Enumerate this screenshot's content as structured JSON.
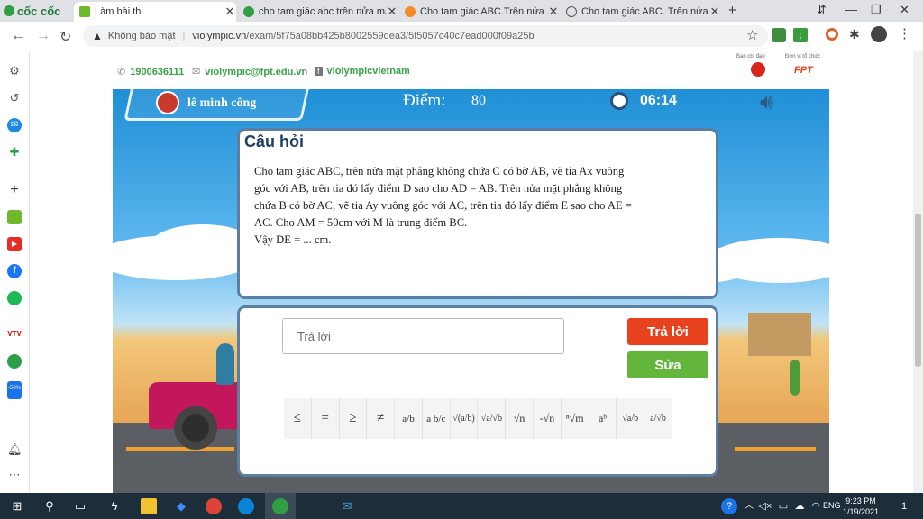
{
  "browser": {
    "logo_text": "cốc cốc",
    "tabs": [
      {
        "title": "Làm bài thi",
        "active": true,
        "icon": "violympic-icon"
      },
      {
        "title": "cho tam giác abc trên nửa mặt",
        "active": false,
        "icon": "coccoc-search-icon"
      },
      {
        "title": "Cho tam giác ABC.Trên nửa m",
        "active": false,
        "icon": "hoc24-icon"
      },
      {
        "title": "Cho tam giác ABC. Trên nửa m",
        "active": false,
        "icon": "globe-icon"
      }
    ],
    "new_tab": "+",
    "address": {
      "security": "Không bảo mật",
      "domain": "violympic.vn",
      "path": "/exam/5f75a08bb425b8002559dea3/5f5057c40c7ead000f09a25b"
    }
  },
  "site": {
    "phone": "1900636111",
    "email": "violympic@fpt.edu.vn",
    "facebook": "violympicvietnam",
    "sponsor1": "Ban chỉ đạo",
    "sponsor2": "Đơn vị tổ chức",
    "fpt_logo": "FPT"
  },
  "game": {
    "player": "lê minh công",
    "score_label": "Điểm:",
    "score": "80",
    "timer": "06:14",
    "question_title": "Câu hỏi",
    "question_text": "Cho tam giác ABC, trên nửa mặt phẳng không chứa C có bờ AB, vẽ tia Ax vuông góc với AB, trên tia đó lấy điểm D sao cho AD = AB. Trên nửa mặt phẳng không chứa B có bờ AC, vẽ tia Ay vuông góc với AC, trên tia đó lấy điểm E sao cho AE = AC. Cho AM = 50cm với M là trung điểm BC.",
    "question_ask": "Vậy DE = ... cm.",
    "answer_placeholder": "Trả lời",
    "submit_label": "Trả lời",
    "edit_label": "Sửa",
    "math_symbols": [
      "≤",
      "=",
      "≥",
      "≠",
      "a/b",
      "a b/c",
      "√(a/b)",
      "√a/√b",
      "√n",
      "-√n",
      "ⁿ√m",
      "aᵇ",
      "√a/b",
      "a/√b"
    ]
  },
  "taskbar": {
    "lang": "ENG",
    "time": "9:23 PM",
    "date": "1/19/2021",
    "notif": "1"
  }
}
